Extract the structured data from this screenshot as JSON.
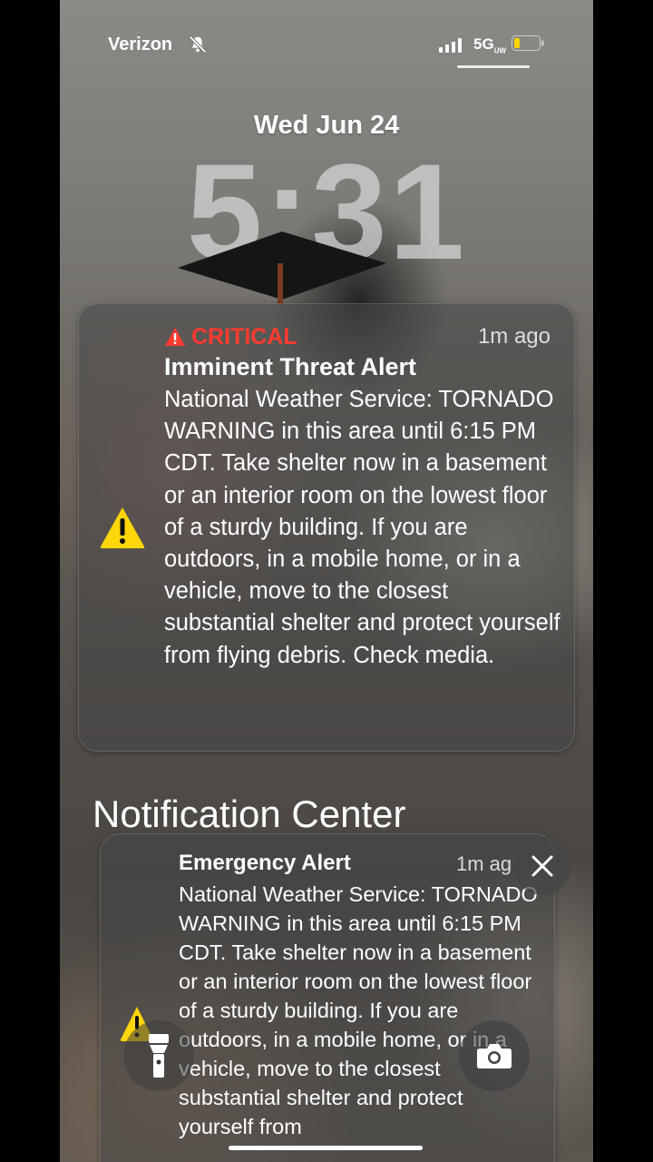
{
  "status_bar": {
    "carrier": "Verizon",
    "network": "5G",
    "network_suffix": "UW",
    "icons": [
      "bell-slash-icon",
      "signal-icon",
      "battery-icon"
    ]
  },
  "lock_screen": {
    "date": "Wed Jun 24",
    "time": "5:31"
  },
  "critical_alert": {
    "badge": "CRITICAL",
    "time_ago": "1m ago",
    "title": "Imminent Threat Alert",
    "body": "National Weather Service: TORNADO WARNING in this area until 6:15 PM CDT. Take shelter now in a basement or an interior room on the lowest floor of a sturdy building. If you are outdoors, in a mobile home, or in a vehicle, move to the closest substantial shelter and protect yourself from flying debris. Check media.",
    "icon": "warning-triangle-icon",
    "badge_color": "#ff3b30",
    "icon_color": "#ffd60a"
  },
  "notification_center": {
    "heading": "Notification Center",
    "emergency_alert": {
      "title": "Emergency Alert",
      "time_ago": "1m ag",
      "body": "National Weather Service: TORNADO WARNING in this area until 6:15 PM CDT. Take shelter now in a basement or an interior room on the lowest floor of a sturdy building. If you are outdoors, in a mobile home, or in a vehicle, move to the closest substantial shelter and protect yourself from",
      "icon": "warning-triangle-icon"
    }
  },
  "quick_actions": {
    "left": "flashlight-icon",
    "right": "camera-icon"
  }
}
